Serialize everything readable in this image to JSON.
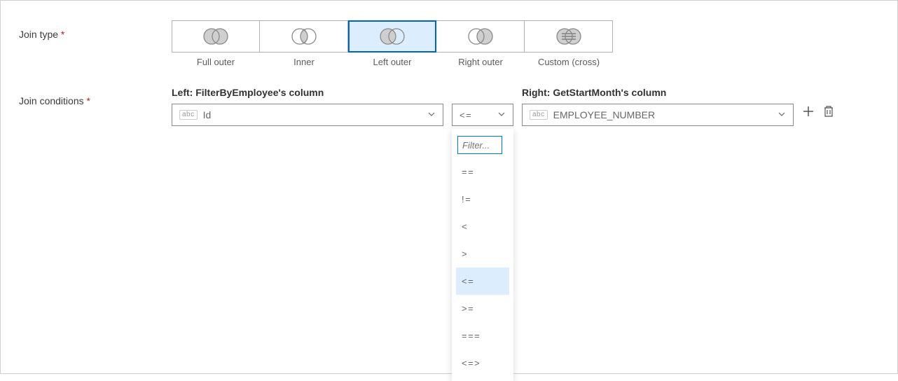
{
  "joinType": {
    "label": "Join type",
    "options": [
      {
        "label": "Full outer",
        "icon": "venn-full",
        "selected": false
      },
      {
        "label": "Inner",
        "icon": "venn-inner",
        "selected": false
      },
      {
        "label": "Left outer",
        "icon": "venn-left",
        "selected": true
      },
      {
        "label": "Right outer",
        "icon": "venn-right",
        "selected": false
      },
      {
        "label": "Custom (cross)",
        "icon": "venn-cross",
        "selected": false
      }
    ]
  },
  "joinConditions": {
    "label": "Join conditions",
    "left": {
      "header": "Left: FilterByEmployee's column",
      "typeBadge": "abc",
      "value": "Id"
    },
    "operator": {
      "value": "<="
    },
    "right": {
      "header": "Right: GetStartMonth's column",
      "typeBadge": "abc",
      "value": "EMPLOYEE_NUMBER"
    },
    "operatorOptions": {
      "filterPlaceholder": "Filter...",
      "items": [
        {
          "v": "==",
          "selected": false
        },
        {
          "v": "!=",
          "selected": false
        },
        {
          "v": "<",
          "selected": false
        },
        {
          "v": ">",
          "selected": false
        },
        {
          "v": "<=",
          "selected": true
        },
        {
          "v": ">=",
          "selected": false
        },
        {
          "v": "===",
          "selected": false
        },
        {
          "v": "<=>",
          "selected": false
        }
      ]
    }
  }
}
